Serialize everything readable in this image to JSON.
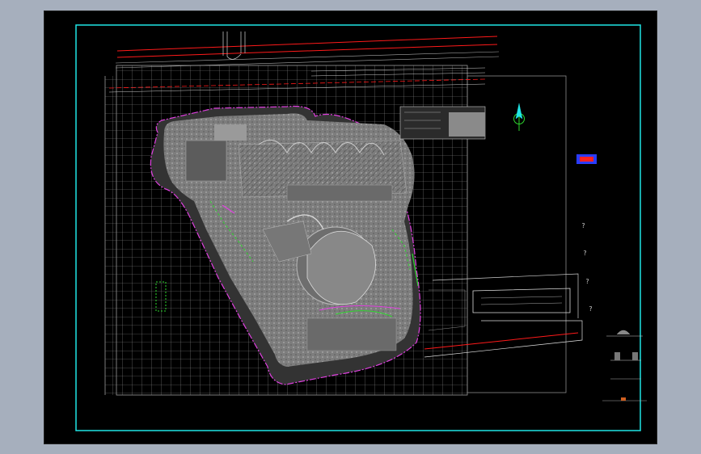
{
  "viewport": {
    "background": "#a6afbd"
  },
  "sheet": {
    "background": "#000000"
  },
  "colors": {
    "frame": "#20e6e6",
    "grid": "#9a9a9a",
    "plan_fill": "#8a8a8a",
    "road_line": "#ff1a1a",
    "accent_magenta": "#e040e0",
    "accent_green": "#2ed82e",
    "legend_blue": "#2a3cff",
    "legend_red": "#ff2020"
  },
  "side_marks": {
    "m1": "?",
    "m2": "?",
    "m3": "?",
    "m4": "?"
  },
  "icons": {
    "north_arrow": "north-arrow-icon",
    "legend_swatch": "legend-swatch-icon"
  }
}
